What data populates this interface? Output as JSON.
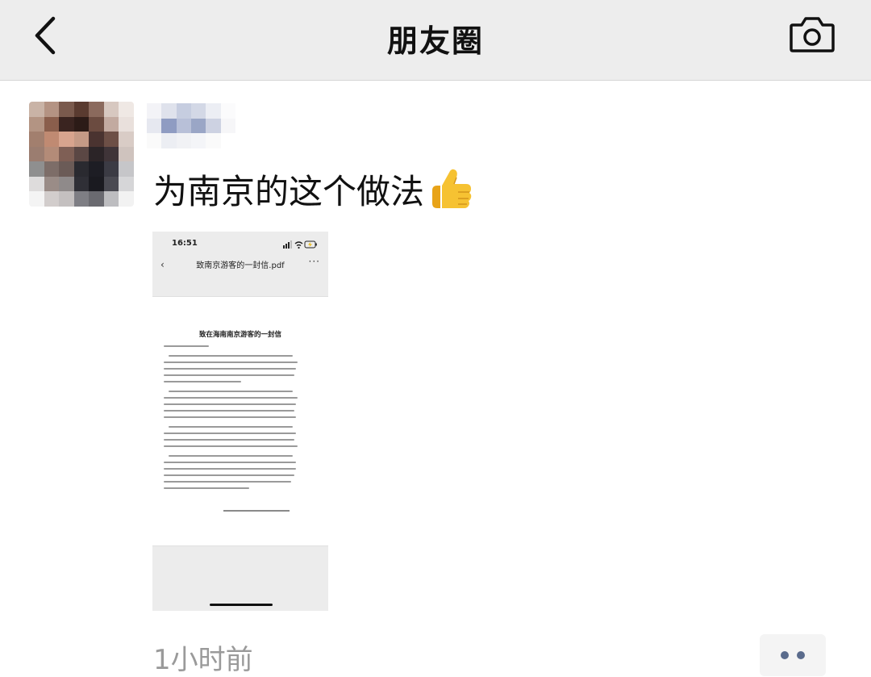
{
  "navbar": {
    "title": "朋友圈",
    "back_icon": "chevron-left-icon",
    "camera_icon": "camera-icon"
  },
  "post": {
    "avatar": "pixelated-avatar",
    "username": "pixelated-username",
    "text": "为南京的这个做法",
    "emoji": "👍",
    "time": "1小时前",
    "more_icon": "two-dots-icon"
  },
  "attachment": {
    "status_time": "16:51",
    "file_title": "致南京游客的一封信.pdf",
    "doc_title": "致在海南南京游客的一封信"
  },
  "colors": {
    "navbar_bg": "#ededed",
    "link_blue": "#5a6b8c",
    "time_gray": "#9a9a9a"
  }
}
